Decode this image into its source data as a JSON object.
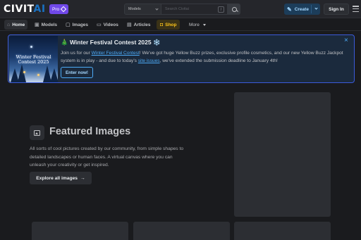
{
  "header": {
    "logo_main": "CIVIT",
    "logo_accent": "AI",
    "pro_label": "Pro",
    "search_scope": "Models",
    "search_placeholder": "Search Civitai",
    "shortcut_key": "/",
    "create_label": "Create",
    "signin_label": "Sign In"
  },
  "nav": {
    "items": [
      {
        "label": "Home",
        "icon": "home-icon"
      },
      {
        "label": "Models",
        "icon": "cube-icon"
      },
      {
        "label": "Images",
        "icon": "photo-icon"
      },
      {
        "label": "Videos",
        "icon": "video-icon"
      },
      {
        "label": "Articles",
        "icon": "book-icon"
      },
      {
        "label": "Shop",
        "icon": "shopping-bag-icon"
      }
    ],
    "more_label": "More",
    "active": "Home"
  },
  "banner": {
    "image_title": "Winter Festival Contest 2025",
    "title": "🎄 Winter Festival Contest 2025 ❄️",
    "body_1": "Join us for our ",
    "link_1": "Winter Festival Contest",
    "body_2": "! We've got huge Yellow Buzz prizes, exclusive profile cosmetics, and our new Yellow Buzz Jackpot system is in play - and due to today's ",
    "link_2": "site issues",
    "body_3": ", we've extended the submission deadline to January 4th!",
    "cta_label": "Enter now!",
    "close_glyph": "×"
  },
  "featured": {
    "title": "Featured Images",
    "description": "All sorts of cool pictures created by our community, from simple shapes to detailed landscapes or human faces. A virtual canvas where you can unleash your creativity or get inspired.",
    "cta_label": "Explore all images",
    "cta_arrow": "→"
  },
  "colors": {
    "background": "#1a1b1e",
    "header": "#25262b",
    "accent_blue": "#4dabf7",
    "shop_yellow": "#fcc419",
    "pro_purple": "#7048e8",
    "card": "#2c2e33"
  }
}
